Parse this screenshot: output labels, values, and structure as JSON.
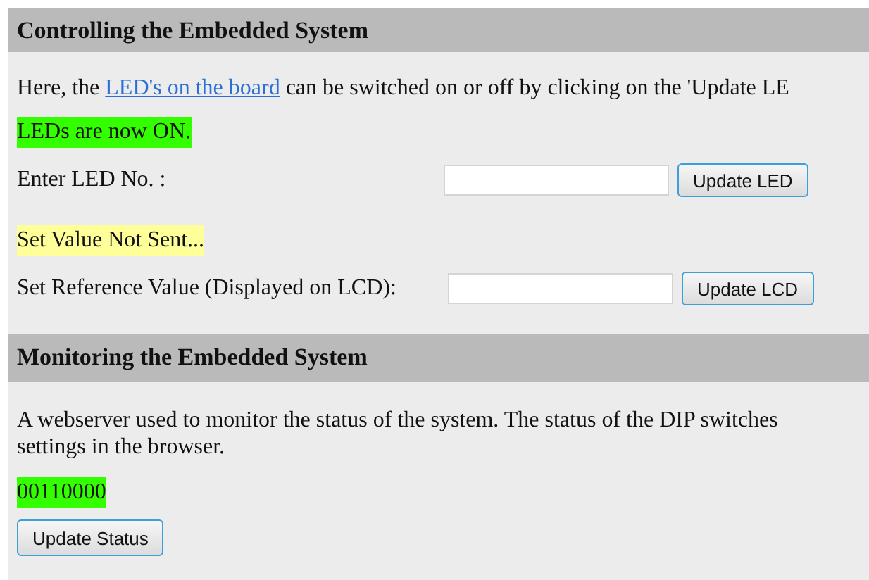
{
  "control_section": {
    "title": "Controlling the Embedded System",
    "intro": {
      "before": "Here, the ",
      "link": "LED's on the board",
      "after": " can be switched on or off by clicking on the 'Update LE"
    },
    "led_status": {
      "text": "LEDs are now ON.",
      "color": "#33ff00"
    },
    "led_input": {
      "label": "Enter LED No. :",
      "button": "Update LED"
    },
    "lcd_status": {
      "text": "Set Value Not Sent...",
      "color": "#ffff99"
    },
    "lcd_input": {
      "label": "Set Reference Value (Displayed on LCD):",
      "button": "Update LCD"
    }
  },
  "monitor_section": {
    "title": "Monitoring the Embedded System",
    "description": [
      "A webserver used to monitor the status of the system. The status of the DIP switches",
      "settings in the browser."
    ],
    "switch_status": {
      "text": "00110000",
      "color": "#33ff00"
    },
    "button": "Update Status"
  }
}
